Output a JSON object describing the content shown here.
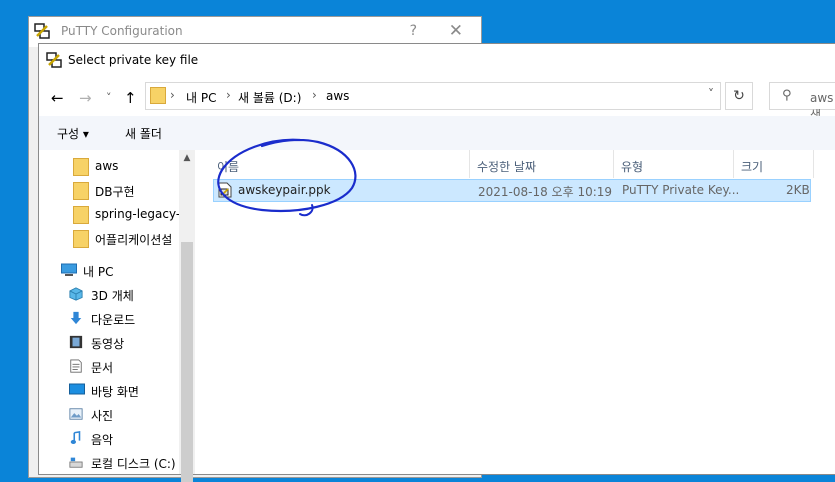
{
  "background_window": {
    "title": "PuTTY Configuration",
    "help_label": "?",
    "close_label": "✕"
  },
  "dialog": {
    "title": "Select private key file"
  },
  "navigation": {
    "back": "←",
    "forward": "→",
    "recent": "˅",
    "up": "↑",
    "breadcrumb": [
      "내 PC",
      "새 볼륨 (D:)",
      "aws"
    ],
    "separator": "›",
    "address_dropdown": "˅",
    "refresh": "↻",
    "search_placeholder": "aws 검색"
  },
  "toolbar": {
    "organize_label": "구성 ▾",
    "new_folder_label": "새 폴더"
  },
  "sidebar": {
    "folders": [
      "aws",
      "DB구현",
      "spring-legacy-m",
      "어플리케이션설"
    ],
    "this_pc": "내 PC",
    "pc_items": [
      "3D 개체",
      "다운로드",
      "동영상",
      "문서",
      "바탕 화면",
      "사진",
      "음악",
      "로컬 디스크 (C:)"
    ]
  },
  "file_list": {
    "columns": [
      "이름",
      "수정한 날짜",
      "유형",
      "크기"
    ],
    "rows": [
      {
        "name": "awskeypair.ppk",
        "modified": "2021-08-18 오후 10:19",
        "type": "PuTTY Private Key...",
        "size": "2KB"
      }
    ]
  },
  "icons": {
    "putty": "putty-icon",
    "folder": "folder-icon",
    "pc": "computer-icon",
    "objects3d": "3d-objects-icon",
    "downloads": "download-arrow-icon",
    "videos": "film-icon",
    "documents": "document-icon",
    "desktop": "desktop-icon",
    "pictures": "pictures-icon",
    "music": "music-note-icon",
    "disk": "disk-icon",
    "key_file": "key-file-icon"
  },
  "colors": {
    "desktop": "#0a84d8",
    "selection": "#cce8ff",
    "selection_border": "#99d1ff",
    "annotation": "#1a2ccc",
    "folder": "#f7d266"
  }
}
